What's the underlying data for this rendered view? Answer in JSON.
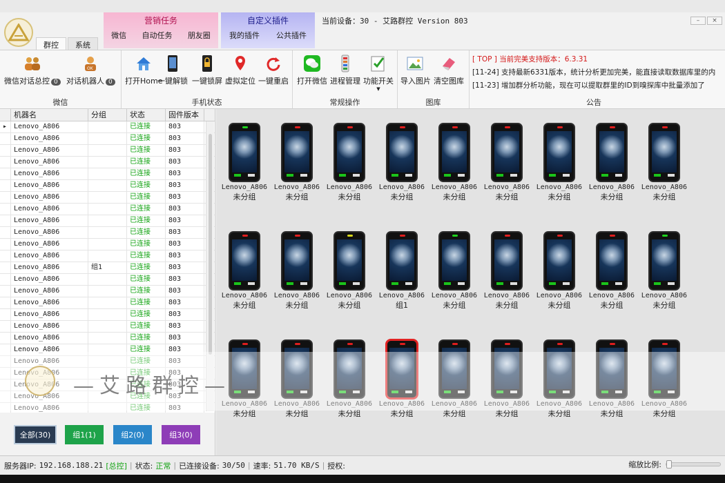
{
  "nav": {
    "tabs": [
      "群控",
      "系统"
    ],
    "active": "群控"
  },
  "marketing": {
    "title": "营销任务",
    "tabs": [
      "微信",
      "自动任务",
      "朋友圈"
    ]
  },
  "custom": {
    "title": "自定义插件",
    "tabs": [
      "我的插件",
      "公共插件"
    ]
  },
  "device_title": "当前设备：30 - 艾路群控 Version 803",
  "ribbon": {
    "wechat": {
      "label": "微信",
      "buttons": [
        {
          "label": "微信对话总控",
          "badge": "0",
          "icon": "people-icon"
        },
        {
          "label": "对话机器人",
          "badge": "0",
          "icon": "robot-user-icon"
        }
      ]
    },
    "phone_state": {
      "label": "手机状态",
      "buttons": [
        {
          "label": "打开Home",
          "icon": "home-icon"
        },
        {
          "label": "一键解锁",
          "icon": "unlock-phone-icon"
        },
        {
          "label": "一键锁屏",
          "icon": "lock-icon"
        },
        {
          "label": "虚拟定位",
          "icon": "location-pin-icon"
        },
        {
          "label": "一键重启",
          "icon": "restart-icon"
        }
      ]
    },
    "common": {
      "label": "常规操作",
      "buttons": [
        {
          "label": "打开微信",
          "icon": "wechat-icon"
        },
        {
          "label": "进程管理",
          "icon": "process-icon"
        },
        {
          "label": "功能开关",
          "icon": "checklist-icon"
        }
      ]
    },
    "gallery": {
      "label": "图库",
      "buttons": [
        {
          "label": "导入图片",
          "icon": "image-import-icon"
        },
        {
          "label": "清空图库",
          "icon": "eraser-icon"
        }
      ]
    },
    "notice": {
      "label": "公告",
      "lines": [
        "[ TOP ] 当前完美支持版本：6.3.31",
        "[11-24] 支持最新6331版本，统计分析更加完美，能直接读取数据库里的内",
        "[11-23] 增加群分析功能，现在可以提取群里的ID到嗅探库中批量添加了"
      ]
    }
  },
  "table": {
    "headers": [
      "机器名",
      "分组",
      "状态",
      "固件版本"
    ],
    "rows": [
      [
        "Lenovo_A806",
        "",
        "已连接",
        "803"
      ],
      [
        "Lenovo_A806",
        "",
        "已连接",
        "803"
      ],
      [
        "Lenovo_A806",
        "",
        "已连接",
        "803"
      ],
      [
        "Lenovo_A806",
        "",
        "已连接",
        "803"
      ],
      [
        "Lenovo_A806",
        "",
        "已连接",
        "803"
      ],
      [
        "Lenovo_A806",
        "",
        "已连接",
        "803"
      ],
      [
        "Lenovo_A806",
        "",
        "已连接",
        "803"
      ],
      [
        "Lenovo_A806",
        "",
        "已连接",
        "803"
      ],
      [
        "Lenovo_A806",
        "",
        "已连接",
        "803"
      ],
      [
        "Lenovo_A806",
        "",
        "已连接",
        "803"
      ],
      [
        "Lenovo_A806",
        "",
        "已连接",
        "803"
      ],
      [
        "Lenovo_A806",
        "",
        "已连接",
        "803"
      ],
      [
        "Lenovo_A806",
        "组1",
        "已连接",
        "803"
      ],
      [
        "Lenovo_A806",
        "",
        "已连接",
        "803"
      ],
      [
        "Lenovo_A806",
        "",
        "已连接",
        "803"
      ],
      [
        "Lenovo_A806",
        "",
        "已连接",
        "803"
      ],
      [
        "Lenovo_A806",
        "",
        "已连接",
        "803"
      ],
      [
        "Lenovo_A806",
        "",
        "已连接",
        "803"
      ],
      [
        "Lenovo_A806",
        "",
        "已连接",
        "803"
      ],
      [
        "Lenovo_A806",
        "",
        "已连接",
        "803"
      ],
      [
        "Lenovo_A806",
        "",
        "已连接",
        "803"
      ],
      [
        "Lenovo_A806",
        "",
        "已连接",
        "803"
      ],
      [
        "Lenovo_A806",
        "",
        "已连接",
        "803"
      ],
      [
        "Lenovo_A806",
        "",
        "已连接",
        "803"
      ],
      [
        "Lenovo_A806",
        "",
        "已连接",
        "803"
      ]
    ]
  },
  "groups": [
    {
      "label": "全部(30)",
      "color": "#2a3b52"
    },
    {
      "label": "组1(1)",
      "color": "#1ea34a"
    },
    {
      "label": "组2(0)",
      "color": "#2a86c9"
    },
    {
      "label": "组3(0)",
      "color": "#8e3db7"
    }
  ],
  "devices": [
    {
      "name": "Lenovo_A806",
      "group": "未分组",
      "led": "#1fd41f"
    },
    {
      "name": "Lenovo_A806",
      "group": "未分组",
      "led": "#e01e1e"
    },
    {
      "name": "Lenovo_A806",
      "group": "未分组",
      "led": "#e01e1e"
    },
    {
      "name": "Lenovo_A806",
      "group": "未分组",
      "led": "#e01e1e"
    },
    {
      "name": "Lenovo_A806",
      "group": "未分组",
      "led": "#e01e1e"
    },
    {
      "name": "Lenovo_A806",
      "group": "未分组",
      "led": "#e01e1e"
    },
    {
      "name": "Lenovo_A806",
      "group": "未分组",
      "led": "#e01e1e"
    },
    {
      "name": "Lenovo_A806",
      "group": "未分组",
      "led": "#e01e1e"
    },
    {
      "name": "Lenovo_A806",
      "group": "未分组",
      "led": "#e01e1e"
    },
    {
      "name": "Lenovo_A806",
      "group": "未分组",
      "led": "#e01e1e"
    },
    {
      "name": "Lenovo_A806",
      "group": "未分组",
      "led": "#e01e1e"
    },
    {
      "name": "Lenovo_A806",
      "group": "未分组",
      "led": "#d9d91a"
    },
    {
      "name": "Lenovo_A806",
      "group": "组1",
      "led": "#e01e1e"
    },
    {
      "name": "Lenovo_A806",
      "group": "未分组",
      "led": "#1fd41f"
    },
    {
      "name": "Lenovo_A806",
      "group": "未分组",
      "led": "#e01e1e"
    },
    {
      "name": "Lenovo_A806",
      "group": "未分组",
      "led": "#e01e1e"
    },
    {
      "name": "Lenovo_A806",
      "group": "未分组",
      "led": "#e01e1e"
    },
    {
      "name": "Lenovo_A806",
      "group": "未分组",
      "led": "#1fd41f"
    },
    {
      "name": "Lenovo_A806",
      "group": "未分组",
      "led": "#e01e1e"
    },
    {
      "name": "Lenovo_A806",
      "group": "未分组",
      "led": "#e01e1e"
    },
    {
      "name": "Lenovo_A806",
      "group": "未分组",
      "led": "#e01e1e"
    },
    {
      "name": "Lenovo_A806",
      "group": "未分组",
      "led": "#e01e1e"
    },
    {
      "name": "Lenovo_A806",
      "group": "未分组",
      "led": "#e01e1e"
    },
    {
      "name": "Lenovo_A806",
      "group": "未分组",
      "led": "#e01e1e"
    },
    {
      "name": "Lenovo_A806",
      "group": "未分组",
      "led": "#e01e1e"
    },
    {
      "name": "Lenovo_A806",
      "group": "未分组",
      "led": "#e01e1e"
    },
    {
      "name": "Lenovo_A806",
      "group": "未分组",
      "led": "#e01e1e"
    }
  ],
  "watermark": "—艾路群控—",
  "status": {
    "server_label": "服务器IP:",
    "server_ip": "192.168.188.21",
    "server_tag": "[总控]",
    "state_label": "状态:",
    "state": "正常",
    "conn_label": "已连接设备:",
    "conn": "30/50",
    "speed_label": "速率:",
    "speed": "51.70 KB/S",
    "auth_label": "授权:",
    "zoom_label": "缩放比例:"
  }
}
